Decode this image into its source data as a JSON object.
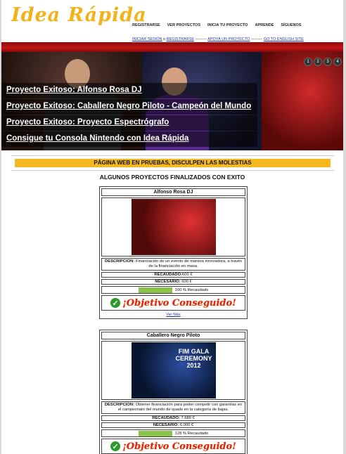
{
  "header": {
    "logo": "Idea Rápida",
    "nav": [
      "REGISTRARSE",
      "VER PROYECTOS",
      "INICIA TU PROYECTO",
      "APRENDE",
      "SÍGUENOS"
    ],
    "sub": {
      "login": "INICIAR SESIÓN",
      "or": "o",
      "register": "REGISTRARSE",
      "sep1": "---------",
      "support": "APOYA UN PROYECTO",
      "sep2": "---------",
      "english": "GO TO ENGLISH SITE"
    }
  },
  "slider": {
    "page_numbers": [
      "1",
      "2",
      "3",
      "4"
    ],
    "captions": [
      "Proyecto Exitoso: Alfonso Rosa DJ",
      "Proyecto Exitoso: Caballero Negro Piloto - Campeón del Mundo",
      "Proyecto Exitoso: Proyecto Espectrógrafo",
      "Consigue tu Consola Nintendo con Idea Rápida"
    ]
  },
  "notice": "PÁGINA WEB EN PRUEBAS, DISCULPEN LAS MOLESTIAS",
  "section_title": "ALGUNOS PROYECTOS FINALIZADOS CON EXITO",
  "projects": [
    {
      "title": "Alfonso Rosa DJ",
      "desc_label": "DESCRIPCION:",
      "desc": "Financiación de un evento de manera innovadora, a través de la financiación en masa.",
      "raised_label": "RECAUDADO:",
      "raised": "600 €",
      "needed_label": "NECESARIO:",
      "needed": "600 €",
      "progress_pct": 100,
      "progress_text": "100 % Recaudado",
      "status": "¡Objetivo Conseguido!",
      "more": "Ver Más"
    },
    {
      "title": "Caballero Negro Piloto",
      "desc_label": "DESCRIPCION:",
      "desc": "Obtener financiación para poder competir con garantías en el campeonato del mundo de quads en la categoría de bajas.",
      "raised_label": "RECAUDADO:",
      "raised": "7.680 €",
      "needed_label": "NECESARIO:",
      "needed": "6.000 €",
      "progress_pct": 128,
      "progress_text": "128 % Recaudado",
      "status": "¡Objetivo Conseguido!",
      "image_text": "FIM GALA CEREMONY 2012"
    }
  ]
}
